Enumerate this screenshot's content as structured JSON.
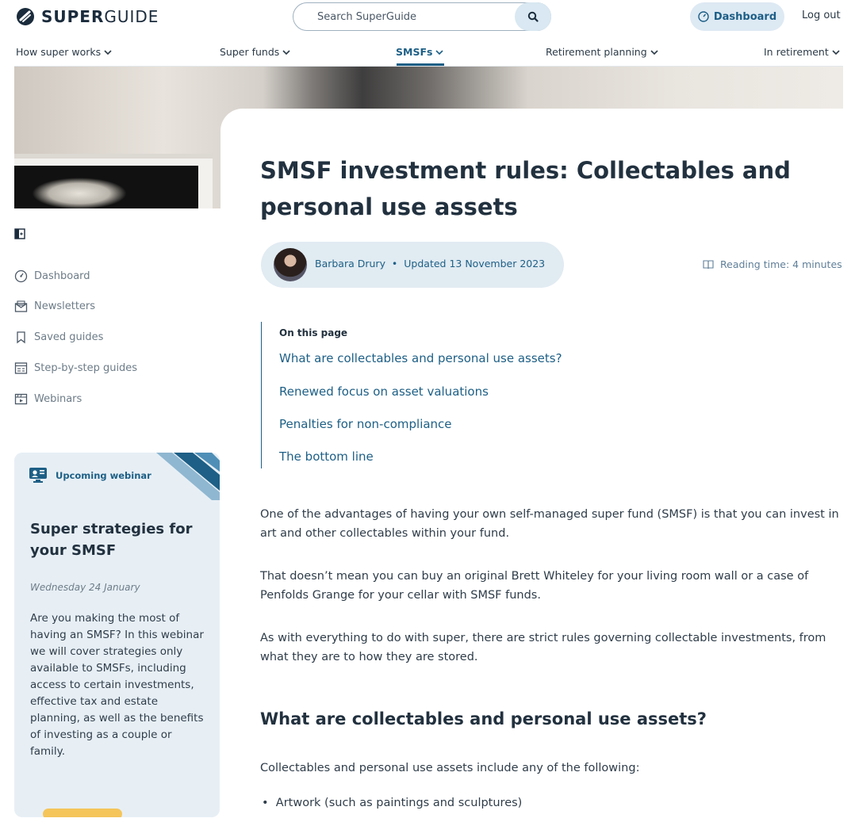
{
  "header": {
    "logo_bold": "SUPER",
    "logo_light": "GUIDE",
    "search_placeholder": "Search SuperGuide",
    "dashboard_label": "Dashboard",
    "logout_label": "Log out"
  },
  "nav": {
    "items": [
      {
        "label": "How super works"
      },
      {
        "label": "Super funds"
      },
      {
        "label": "SMSFs"
      },
      {
        "label": "Retirement planning"
      },
      {
        "label": "In retirement"
      }
    ]
  },
  "article": {
    "title": "SMSF investment rules: Collectables and personal use assets",
    "author": "Barbara Drury",
    "updated": "Updated 13 November 2023",
    "reading_time": "Reading time: 4 minutes",
    "toc_title": "On this page",
    "toc": [
      "What are collectables and personal use assets?",
      "Renewed focus on asset valuations",
      "Penalties for non-compliance",
      "The bottom line"
    ],
    "paragraphs": [
      "One of the advantages of having your own self-managed super fund (SMSF) is that you can invest in art and other collectables within your fund.",
      "That doesn’t mean you can buy an original Brett Whiteley for your living room wall or a case of Penfolds Grange for your cellar with SMSF funds.",
      "As with everything to do with super, there are strict rules governing collectable investments, from what they are to how they are stored."
    ],
    "section_heading": "What are collectables and personal use assets?",
    "section_intro": "Collectables and personal use assets include any of the following:",
    "bullets": [
      "Artwork (such as paintings and sculptures)"
    ]
  },
  "sidebar": {
    "items": [
      {
        "label": "Dashboard",
        "icon": "dashboard-gauge-icon"
      },
      {
        "label": "Newsletters",
        "icon": "newsletter-icon"
      },
      {
        "label": "Saved guides",
        "icon": "bookmark-icon"
      },
      {
        "label": "Step-by-step guides",
        "icon": "checklist-icon"
      },
      {
        "label": "Webinars",
        "icon": "webinar-icon"
      }
    ]
  },
  "webinar": {
    "badge": "Upcoming webinar",
    "title": "Super strategies for your SMSF",
    "date": "Wednesday 24 January",
    "description": "Are you making the most of having an SMSF? In this webinar we will cover strategies only available to SMSFs, including access to certain investments, effective tax and estate planning, as well as the benefits of investing as a couple or family."
  },
  "colors": {
    "brand_blue": "#1d5f86",
    "pill_bg": "#e1ebf2",
    "webinar_bg": "#e7eff5",
    "cta_yellow": "#f5c55a"
  }
}
